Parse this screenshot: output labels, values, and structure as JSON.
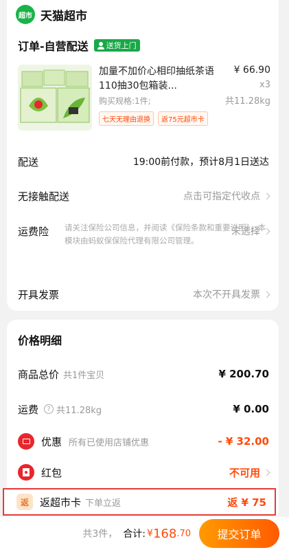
{
  "store": {
    "logo_text": "超市",
    "name": "天猫超市"
  },
  "order": {
    "title": "订单-自营配送",
    "delivery_tag": "送货上门"
  },
  "product": {
    "title": "加量不加价心相印抽纸茶语110抽30包箱装...",
    "spec": "购买规格:1件;",
    "price": "¥ 66.90",
    "qty": "x3",
    "weight": "共11.28kg",
    "tags": [
      "七天无理由退换",
      "返75元超市卡"
    ]
  },
  "rows": {
    "delivery": {
      "label": "配送",
      "value": "19:00前付款，预计8月1日送达"
    },
    "contactless": {
      "label": "无接触配送",
      "value": "点击可指定代收点"
    },
    "insurance": {
      "label": "运费险",
      "value": "未选择",
      "note": "请关注保险公司信息，并阅读《保险条款和重要说明》，本模块由蚂蚁保保险代理有限公司管理。"
    },
    "invoice": {
      "label": "开具发票",
      "value": "本次不开具发票"
    }
  },
  "price": {
    "title": "价格明细",
    "goods": {
      "label": "商品总价",
      "sub": "共1件宝贝",
      "amount": "¥ 200.70"
    },
    "shipping": {
      "label": "运费",
      "help": "?",
      "sub": "共11.28kg",
      "amount": "¥ 0.00"
    },
    "discount": {
      "label": "优惠",
      "sub": "所有已使用店铺优惠",
      "amount": "- ¥ 32.00"
    },
    "red_packet": {
      "label": "红包",
      "amount": "不可用"
    },
    "rebate": {
      "icon_text": "返",
      "label": "返超市卡",
      "sub": "下单立返",
      "amount": "返 ¥ 75"
    }
  },
  "bottom": {
    "count": "共3件，",
    "total_label": "合计:",
    "total_symbol": "¥",
    "total_int": "168",
    "total_dec": ".70",
    "submit": "提交订单"
  },
  "colors": {
    "accent": "#ff4a0a",
    "brand_green": "#19b34a",
    "highlight_border": "#e53935"
  }
}
